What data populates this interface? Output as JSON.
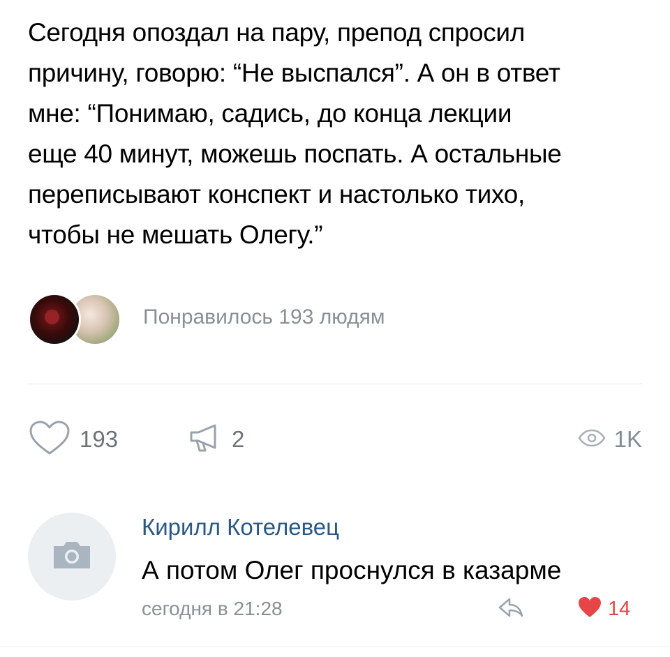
{
  "post": {
    "text_lines": [
      "Сегодня опоздал на пару, препод спросил",
      "причину, говорю: “Не выспался”. А он в ответ",
      "мне: “Понимаю, садись, до конца лекции",
      "еще 40 минут, можешь поспать. А остальные",
      "переписывают конспект и настолько тихо,",
      "чтобы не мешать Олегу.”"
    ],
    "likers_text": "Понравилось 193 людям"
  },
  "actions": {
    "likes": {
      "icon": "heart-outline-icon",
      "count": "193"
    },
    "shares": {
      "icon": "megaphone-icon",
      "count": "2"
    },
    "views": {
      "icon": "eye-icon",
      "count": "1K"
    }
  },
  "comment": {
    "avatar_icon": "camera-icon",
    "author": "Кирилл Котелевец",
    "text": "А потом Олег проснулся в казарме",
    "time": "сегодня в 21:28",
    "reply_icon": "reply-icon",
    "like_icon": "heart-filled-icon",
    "likes": "14"
  },
  "colors": {
    "author_link": "#2a5885",
    "secondary_text": "#8a8f96",
    "heart_active": "#e64646",
    "icon_grey": "#99a2ad"
  }
}
